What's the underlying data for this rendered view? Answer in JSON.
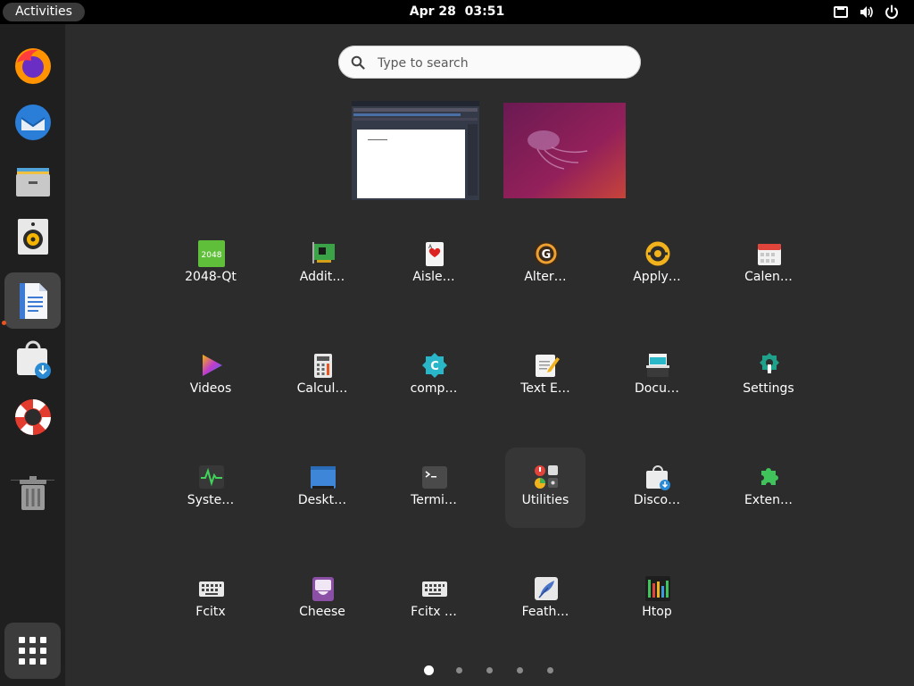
{
  "topbar": {
    "activities": "Activities",
    "date": "Apr 28",
    "time": "03:51",
    "tray_icons": [
      "network-icon",
      "volume-icon",
      "power-icon"
    ]
  },
  "dock": {
    "items": [
      {
        "name": "Firefox",
        "icon": "firefox-icon"
      },
      {
        "name": "Thunderbird",
        "icon": "thunderbird-icon"
      },
      {
        "name": "Files",
        "icon": "files-icon"
      },
      {
        "name": "Rhythmbox",
        "icon": "rhythmbox-icon"
      },
      {
        "name": "LibreOffice Writer",
        "icon": "writer-icon",
        "active": true
      },
      {
        "name": "Software",
        "icon": "software-icon"
      },
      {
        "name": "Help",
        "icon": "help-icon"
      },
      {
        "name": "Trash",
        "icon": "trash-icon"
      }
    ],
    "show_apps": "show-apps-icon"
  },
  "search": {
    "placeholder": "Type to search"
  },
  "windows": [
    "writer-window",
    "desktop-wallpaper"
  ],
  "apps": [
    {
      "label": "2048-Qt",
      "icon": "2048-icon"
    },
    {
      "label": "Addit…",
      "icon": "additional-drivers-icon"
    },
    {
      "label": "Aisle…",
      "icon": "cards-icon"
    },
    {
      "label": "Alter…",
      "icon": "alternatives-icon"
    },
    {
      "label": "Apply…",
      "icon": "apply-icon"
    },
    {
      "label": "Calen…",
      "icon": "calendar-icon"
    },
    {
      "label": "Videos",
      "icon": "videos-icon"
    },
    {
      "label": "Calcul…",
      "icon": "calculator-icon"
    },
    {
      "label": "comp…",
      "icon": "compiz-icon"
    },
    {
      "label": "Text E…",
      "icon": "text-editor-icon"
    },
    {
      "label": "Docu…",
      "icon": "document-scanner-icon"
    },
    {
      "label": "Settings",
      "icon": "settings-icon"
    },
    {
      "label": "Syste…",
      "icon": "system-monitor-icon"
    },
    {
      "label": "Deskt…",
      "icon": "desktop-icon"
    },
    {
      "label": "Termi…",
      "icon": "terminal-icon"
    },
    {
      "label": "Utilities",
      "icon": "utilities-folder-icon",
      "folder": true
    },
    {
      "label": "Disco…",
      "icon": "discover-icon"
    },
    {
      "label": "Exten…",
      "icon": "extensions-icon"
    },
    {
      "label": "Fcitx",
      "icon": "keyboard-icon"
    },
    {
      "label": "Cheese",
      "icon": "cheese-icon"
    },
    {
      "label": "Fcitx …",
      "icon": "keyboard-icon"
    },
    {
      "label": "Feath…",
      "icon": "feather-icon"
    },
    {
      "label": "Htop",
      "icon": "htop-icon"
    }
  ],
  "pages": {
    "count": 5,
    "current": 1
  }
}
